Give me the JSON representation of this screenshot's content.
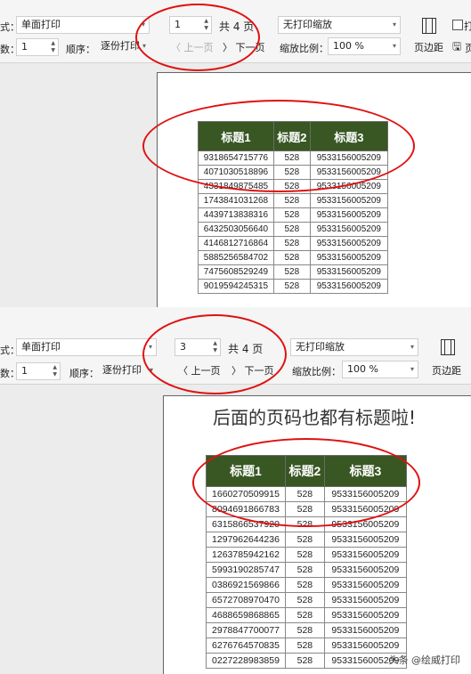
{
  "top_panel": {
    "style_label": "式：",
    "style_value": "单面打印",
    "copies_label": "数：",
    "copies_value": "1",
    "order_label": "顺序：",
    "order_value": "逐份打印",
    "page_input": "1",
    "page_total": "共 4 页",
    "prev_page": "上一页",
    "next_page": "下一页",
    "scale_mode": "无打印缩放",
    "scale_ratio_label": "缩放比例：",
    "scale_ratio_value": "100 %",
    "margins_label": "页边距",
    "extra_check_label": "打",
    "extra_label": "页",
    "table": {
      "headers": [
        "标题1",
        "标题2",
        "标题3"
      ],
      "rows": [
        [
          "9318654715776",
          "528",
          "9533156005209"
        ],
        [
          "4071030518896",
          "528",
          "9533156005209"
        ],
        [
          "4331849875485",
          "528",
          "9533156005209"
        ],
        [
          "1743841031268",
          "528",
          "9533156005209"
        ],
        [
          "4439713838316",
          "528",
          "9533156005209"
        ],
        [
          "6432503056640",
          "528",
          "9533156005209"
        ],
        [
          "4146812716864",
          "528",
          "9533156005209"
        ],
        [
          "5885256584702",
          "528",
          "9533156005209"
        ],
        [
          "7475608529249",
          "528",
          "9533156005209"
        ],
        [
          "9019594245315",
          "528",
          "9533156005209"
        ]
      ]
    }
  },
  "bottom_panel": {
    "style_label": "式：",
    "style_value": "单面打印",
    "copies_label": "数：",
    "copies_value": "1",
    "order_label": "顺序：",
    "order_value": "逐份打印",
    "page_input": "3",
    "page_total": "共 4 页",
    "prev_page": "上一页",
    "next_page": "下一页",
    "scale_mode": "无打印缩放",
    "scale_ratio_label": "缩放比例：",
    "scale_ratio_value": "100 %",
    "margins_label": "页边距",
    "note": "后面的页码也都有标题啦!",
    "table": {
      "headers": [
        "标题1",
        "标题2",
        "标题3"
      ],
      "rows": [
        [
          "1660270509915",
          "528",
          "9533156005209"
        ],
        [
          "8094691866783",
          "528",
          "9533156005209"
        ],
        [
          "6315866537920",
          "528",
          "9533156005209"
        ],
        [
          "1297962644236",
          "528",
          "9533156005209"
        ],
        [
          "1263785942162",
          "528",
          "9533156005209"
        ],
        [
          "5993190285747",
          "528",
          "9533156005209"
        ],
        [
          "0386921569866",
          "528",
          "9533156005209"
        ],
        [
          "6572708970470",
          "528",
          "9533156005209"
        ],
        [
          "4688659868865",
          "528",
          "9533156005209"
        ],
        [
          "2978847700077",
          "528",
          "9533156005209"
        ],
        [
          "6276764570835",
          "528",
          "9533156005209"
        ],
        [
          "0227228983859",
          "528",
          "9533156005209"
        ]
      ]
    }
  },
  "watermark": "头条 @绘威打印",
  "colors": {
    "header_bg": "#385723",
    "annotation": "#e01010"
  }
}
